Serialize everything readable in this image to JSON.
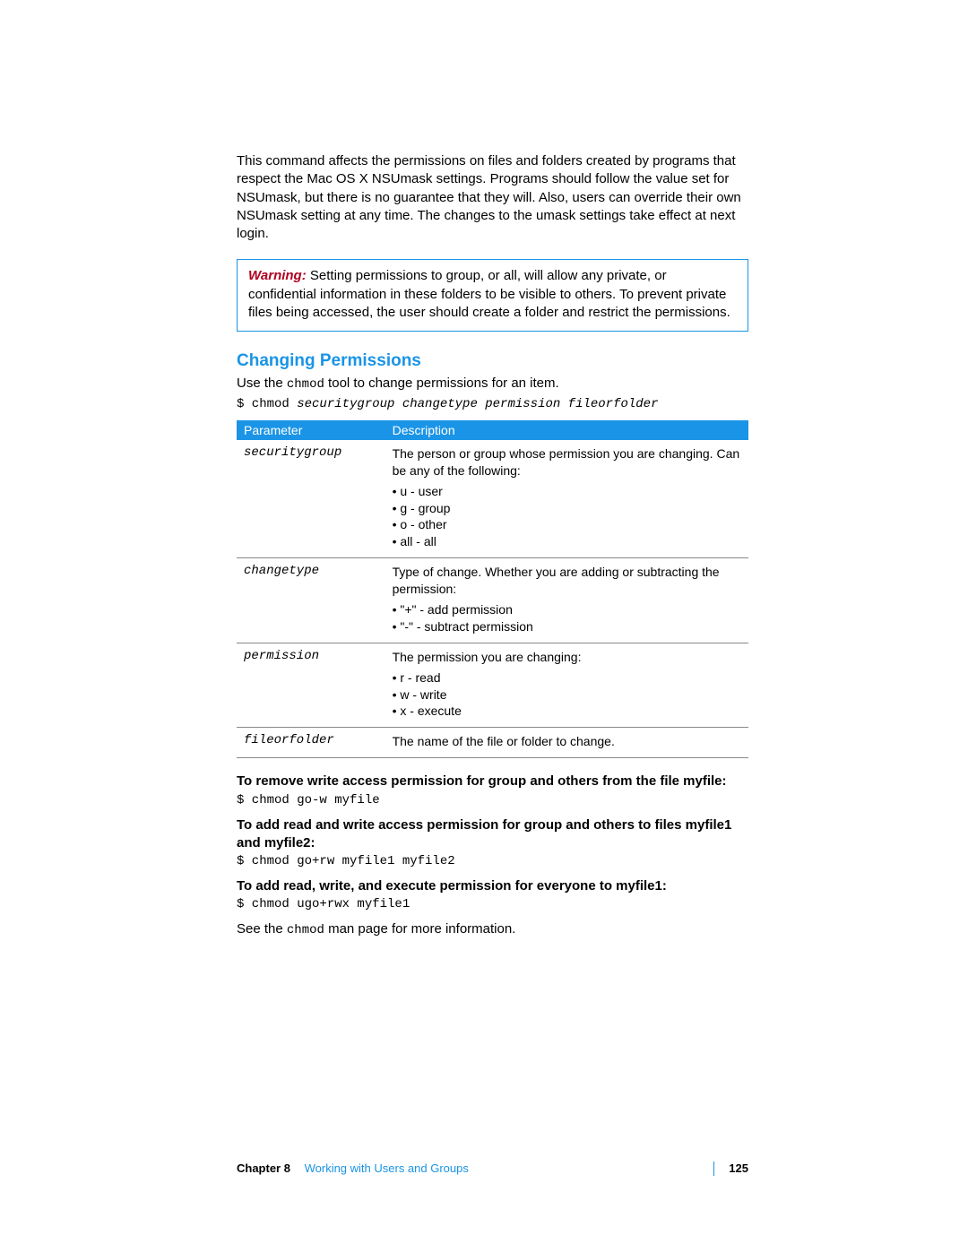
{
  "intro_paragraph": "This command affects the permissions on files and folders created by programs that respect the Mac OS X NSUmask settings. Programs should follow the value set for NSUmask, but there is no guarantee that they will. Also, users can override their own NSUmask setting at any time. The changes to the umask settings take effect at next login.",
  "warning": {
    "label": "Warning:",
    "text": "Setting permissions to group, or all, will allow any private, or confidential information in these folders to be visible to others. To prevent private files being accessed, the user should create a folder and restrict the permissions."
  },
  "section_title": "Changing Permissions",
  "section_intro_pre": "Use the ",
  "section_intro_code": "chmod",
  "section_intro_post": " tool to change permissions for an item.",
  "command_line": {
    "prefix": "$ chmod ",
    "args": "securitygroup changetype permission fileorfolder"
  },
  "table": {
    "head_param": "Parameter",
    "head_desc": "Description",
    "rows": [
      {
        "param": "securitygroup",
        "intro": "The person or group whose permission you are changing. Can be any of the following:",
        "bullets": [
          "u - user",
          "g - group",
          "o - other",
          "all - all"
        ]
      },
      {
        "param": "changetype",
        "intro": "Type of change. Whether you are adding or subtracting the permission:",
        "bullets": [
          "\"+\" - add permission",
          "\"-\" - subtract permission"
        ]
      },
      {
        "param": "permission",
        "intro": "The permission you are changing:",
        "bullets": [
          "r - read",
          "w - write",
          "x - execute"
        ]
      },
      {
        "param": "fileorfolder",
        "intro": "The name of the file or folder to change.",
        "bullets": []
      }
    ]
  },
  "examples": [
    {
      "heading": "To remove write access permission for group and others from the file myfile:",
      "command": "$ chmod go-w myfile"
    },
    {
      "heading": "To add read and write access permission for group and others to files myfile1 and myfile2:",
      "command": "$ chmod go+rw myfile1 myfile2"
    },
    {
      "heading": "To add read, write, and execute permission for everyone to myfile1:",
      "command": "$ chmod ugo+rwx myfile1"
    }
  ],
  "closing_pre": "See the ",
  "closing_code": "chmod",
  "closing_post": " man page for more information.",
  "footer": {
    "chapter_label": "Chapter 8",
    "chapter_title": "Working with Users and Groups",
    "page_number": "125"
  }
}
